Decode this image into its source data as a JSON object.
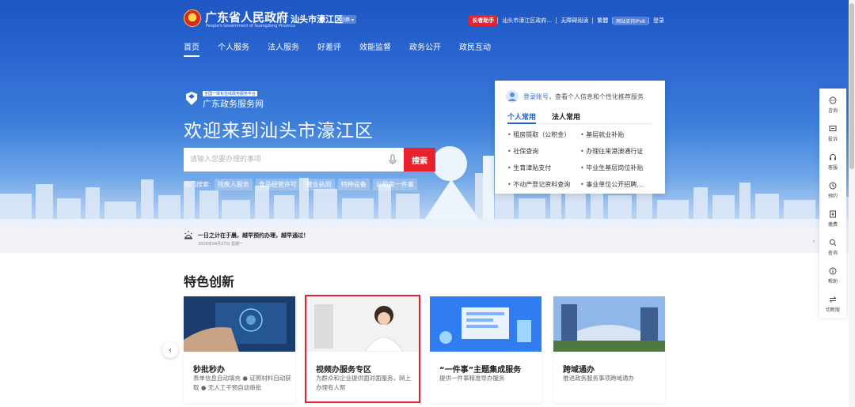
{
  "header": {
    "gov_name": "广东省人民政府",
    "gov_name_en": "People's Government of Guangdong Province",
    "region": "汕头市濠江区",
    "switch_label": "切换 ▾",
    "links": {
      "elder": "长者助手",
      "site": "汕头市濠江区政府…",
      "accessible": "无障碍阅读",
      "traditional": "繁體",
      "ipv6": "网站支持IPv6",
      "login": "登录"
    }
  },
  "nav": [
    "首页",
    "个人服务",
    "法人服务",
    "好差评",
    "效能监督",
    "政务公开",
    "政民互动"
  ],
  "portal": {
    "tag": "全国一体化在线政务服务平台",
    "name": "广东政务服务网"
  },
  "welcome": "欢迎来到汕头市濠江区",
  "search": {
    "placeholder": "请输入您要办理的事项",
    "button": "搜索"
  },
  "hot_search": {
    "label": "热门搜索:",
    "tags": [
      "残疾人服务",
      "食品经营许可",
      "营业执照",
      "特种设备",
      "公租房一件事"
    ]
  },
  "login_panel": {
    "login_link": "登录账号",
    "login_desc": "，查看个人信息和个性化推荐服务",
    "tabs": [
      "个人常用",
      "法人常用"
    ],
    "items": [
      "租房提取（公积金）",
      "基层就业补贴",
      "社保查询",
      "办理往来港澳通行证",
      "生育津贴支付",
      "毕业生基层岗位补贴",
      "不动产登记资料查询",
      "事业单位公开招聘…"
    ]
  },
  "notice": {
    "text": "一日之计在于晨，越早预约办理，越早通过！",
    "date": "2026年04月27日 星期一"
  },
  "features": {
    "title": "特色创新",
    "cards": [
      {
        "title": "秒批秒办",
        "desc": "表单信息自动填充 ● 证照材料自动获取 ● 无人工干预自动审批"
      },
      {
        "title": "视频办服务专区",
        "desc": "为群众和企业提供面对面服务，网上办理有人帮"
      },
      {
        "title": "“一件事”主题集成服务",
        "desc": "提供一件事精准导办服务"
      },
      {
        "title": "跨域通办",
        "desc": "推进政务服务事项跨域通办"
      }
    ]
  },
  "sidebar": {
    "items": [
      "咨询",
      "投诉",
      "客服",
      "预约",
      "缴费",
      "查询",
      "帮助",
      "切新版"
    ],
    "collapse": "‹"
  },
  "colors": {
    "primary_blue": "#1e56c4",
    "accent_red": "#e8212c",
    "link_blue": "#2a6fd6"
  }
}
